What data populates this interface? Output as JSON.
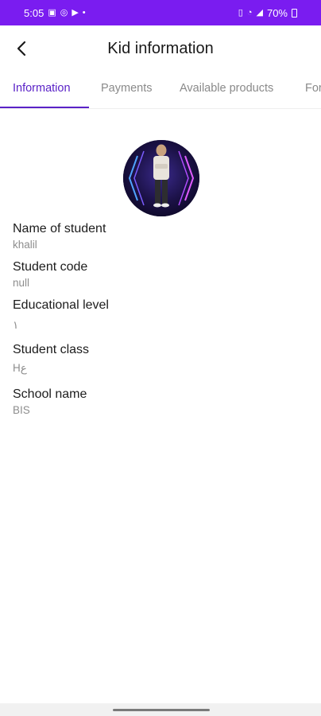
{
  "status_bar": {
    "time": "5:05",
    "left_icons": [
      "image-icon",
      "whatsapp-icon",
      "youtube-icon",
      "dot-icon"
    ],
    "right_icons": [
      "vibrate-icon",
      "wifi-icon",
      "signal-icon"
    ],
    "battery": "70%"
  },
  "header": {
    "title": "Kid information",
    "back_icon": "arrow-left-icon"
  },
  "tabs": [
    {
      "label": "Information",
      "active": true
    },
    {
      "label": "Payments",
      "active": false
    },
    {
      "label": "Available products",
      "active": false
    },
    {
      "label": "For",
      "active": false
    }
  ],
  "student": {
    "fields": [
      {
        "label": "Name of student",
        "value": "khalil"
      },
      {
        "label": "Student code",
        "value": "null"
      },
      {
        "label": "Educational level",
        "value": "١"
      },
      {
        "label": "Student class",
        "value": "Hع"
      },
      {
        "label": "School name",
        "value": "BIS"
      }
    ]
  },
  "colors": {
    "status_bar": "#7a1cf0",
    "accent": "#5a22c7",
    "inactive_tab": "#8a8a8a",
    "value_text": "#8d8d8d"
  }
}
